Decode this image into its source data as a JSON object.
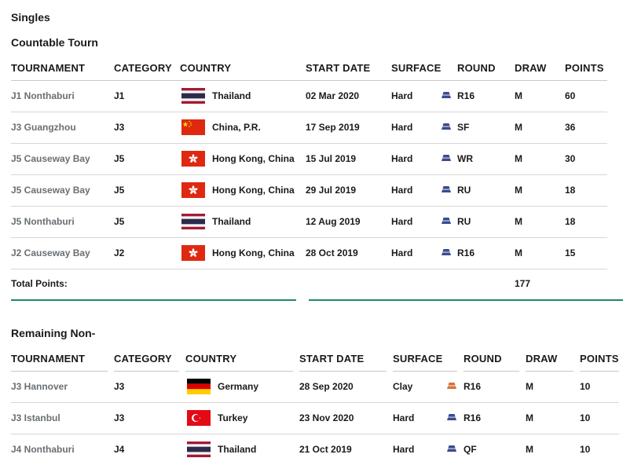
{
  "header": {
    "section_title": "Singles"
  },
  "countable": {
    "title": "Countable Tourn",
    "columns": [
      "TOURNAMENT",
      "CATEGORY",
      "COUNTRY",
      "START DATE",
      "SURFACE",
      "ROUND",
      "DRAW",
      "POINTS"
    ],
    "rows": [
      {
        "tournament": "J1 Nonthaburi",
        "category": "J1",
        "flag": "thailand-flag-icon",
        "country": "Thailand",
        "start_date": "02 Mar 2020",
        "surface": "Hard",
        "surface_icon": "hard-court-icon",
        "round": "R16",
        "draw": "M",
        "points": "60"
      },
      {
        "tournament": "J3 Guangzhou",
        "category": "J3",
        "flag": "china-flag-icon",
        "country": "China, P.R.",
        "start_date": "17 Sep 2019",
        "surface": "Hard",
        "surface_icon": "hard-court-icon",
        "round": "SF",
        "draw": "M",
        "points": "36"
      },
      {
        "tournament": "J5 Causeway Bay",
        "category": "J5",
        "flag": "hong-kong-flag-icon",
        "country": "Hong Kong, China",
        "start_date": "15 Jul 2019",
        "surface": "Hard",
        "surface_icon": "hard-court-icon",
        "round": "WR",
        "draw": "M",
        "points": "30"
      },
      {
        "tournament": "J5 Causeway Bay",
        "category": "J5",
        "flag": "hong-kong-flag-icon",
        "country": "Hong Kong, China",
        "start_date": "29 Jul 2019",
        "surface": "Hard",
        "surface_icon": "hard-court-icon",
        "round": "RU",
        "draw": "M",
        "points": "18"
      },
      {
        "tournament": "J5 Nonthaburi",
        "category": "J5",
        "flag": "thailand-flag-icon",
        "country": "Thailand",
        "start_date": "12 Aug 2019",
        "surface": "Hard",
        "surface_icon": "hard-court-icon",
        "round": "RU",
        "draw": "M",
        "points": "18"
      },
      {
        "tournament": "J2 Causeway Bay",
        "category": "J2",
        "flag": "hong-kong-flag-icon",
        "country": "Hong Kong, China",
        "start_date": "28 Oct 2019",
        "surface": "Hard",
        "surface_icon": "hard-court-icon",
        "round": "R16",
        "draw": "M",
        "points": "15"
      }
    ],
    "total_label": "Total Points:",
    "total_value": "177"
  },
  "remaining": {
    "title": "Remaining Non-",
    "columns": [
      "TOURNAMENT",
      "CATEGORY",
      "COUNTRY",
      "START DATE",
      "SURFACE",
      "ROUND",
      "DRAW",
      "POINTS"
    ],
    "rows": [
      {
        "tournament": "J3 Hannover",
        "category": "J3",
        "flag": "germany-flag-icon",
        "country": "Germany",
        "start_date": "28 Sep 2020",
        "surface": "Clay",
        "surface_icon": "clay-court-icon",
        "round": "R16",
        "draw": "M",
        "points": "10"
      },
      {
        "tournament": "J3 Istanbul",
        "category": "J3",
        "flag": "turkey-flag-icon",
        "country": "Turkey",
        "start_date": "23 Nov 2020",
        "surface": "Hard",
        "surface_icon": "hard-court-icon",
        "round": "R16",
        "draw": "M",
        "points": "10"
      },
      {
        "tournament": "J4 Nonthaburi",
        "category": "J4",
        "flag": "thailand-flag-icon",
        "country": "Thailand",
        "start_date": "21 Oct 2019",
        "surface": "Hard",
        "surface_icon": "hard-court-icon",
        "round": "QF",
        "draw": "M",
        "points": "10"
      }
    ]
  },
  "colors": {
    "hard": "#3b4a8f",
    "clay": "#d9703a",
    "accent_line": "#1d8a6b"
  }
}
